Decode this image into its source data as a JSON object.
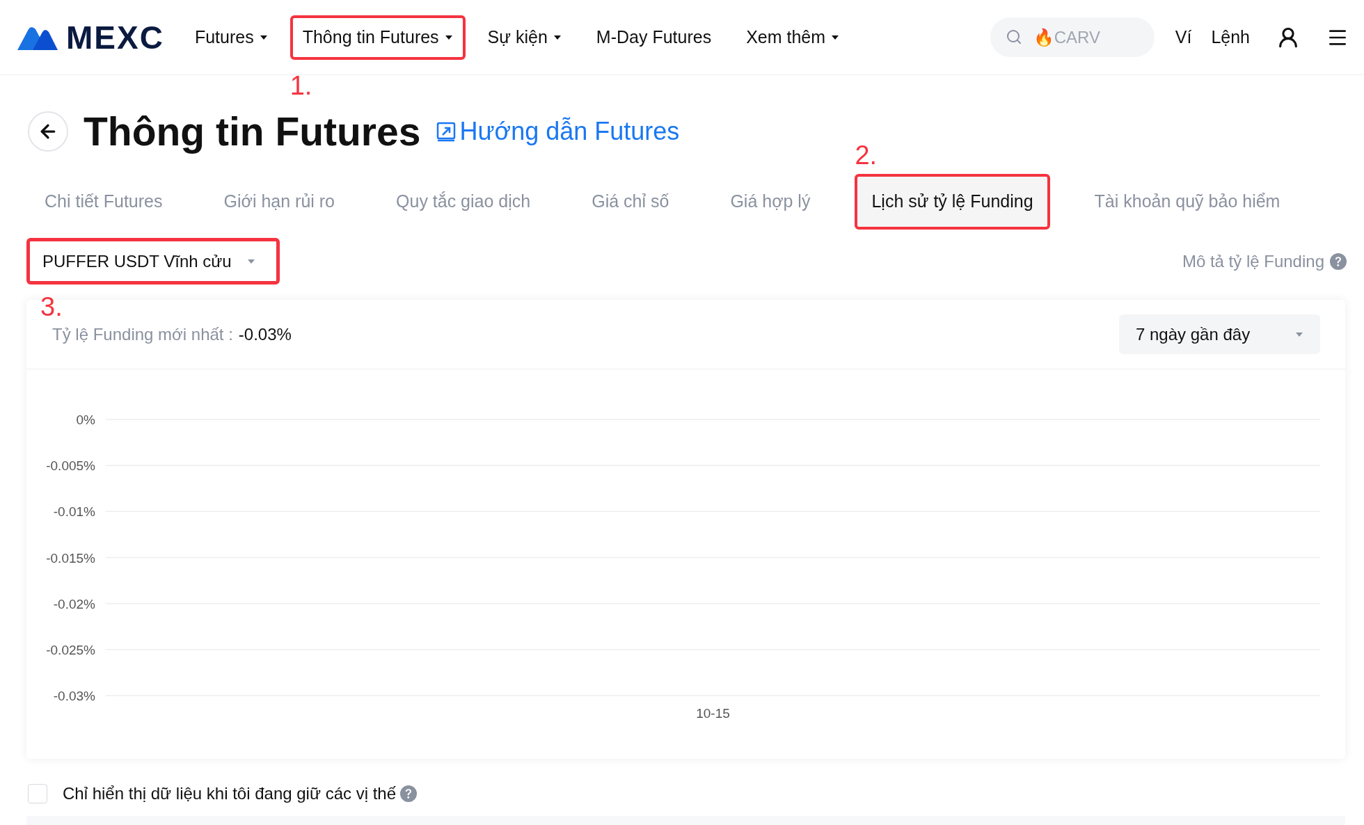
{
  "header": {
    "logo": "MEXC",
    "nav": [
      {
        "label": "Futures",
        "dropdown": true,
        "highlighted": false
      },
      {
        "label": "Thông tin Futures",
        "dropdown": true,
        "highlighted": true,
        "annotation": "1."
      },
      {
        "label": "Sự kiện",
        "dropdown": true,
        "highlighted": false
      },
      {
        "label": "M-Day Futures",
        "dropdown": false,
        "highlighted": false
      },
      {
        "label": "Xem thêm",
        "dropdown": true,
        "highlighted": false
      }
    ],
    "search": {
      "placeholder": "🔥CARV"
    },
    "links": [
      "Ví",
      "Lệnh"
    ]
  },
  "page": {
    "title": "Thông tin Futures",
    "guide_link": "Hướng dẫn Futures"
  },
  "tabs": [
    {
      "label": "Chi tiết Futures",
      "selected": false,
      "highlighted": false
    },
    {
      "label": "Giới hạn rủi ro",
      "selected": false,
      "highlighted": false
    },
    {
      "label": "Quy tắc giao dịch",
      "selected": false,
      "highlighted": false
    },
    {
      "label": "Giá chỉ số",
      "selected": false,
      "highlighted": false
    },
    {
      "label": "Giá hợp lý",
      "selected": false,
      "highlighted": false
    },
    {
      "label": "Lịch sử tỷ lệ Funding",
      "selected": true,
      "highlighted": true,
      "annotation": "2."
    },
    {
      "label": "Tài khoản quỹ bảo hiểm",
      "selected": false,
      "highlighted": false
    }
  ],
  "contract_select": {
    "value": "PUFFER USDT Vĩnh cửu",
    "highlighted": true,
    "annotation": "3."
  },
  "funding_description_link": "Mô tả tỷ lệ Funding",
  "card": {
    "latest_label": "Tỷ lệ Funding mới nhất :",
    "latest_value": "-0.03%",
    "period_select": "7 ngày gần đây",
    "chart_data": {
      "type": "line",
      "grid": true,
      "categories": [
        "10-15"
      ],
      "ylim": [
        -0.03,
        0
      ],
      "yticks": [
        {
          "value": 0,
          "label": "0%"
        },
        {
          "value": -0.005,
          "label": "-0.005%"
        },
        {
          "value": -0.01,
          "label": "-0.01%"
        },
        {
          "value": -0.015,
          "label": "-0.015%"
        },
        {
          "value": -0.02,
          "label": "-0.02%"
        },
        {
          "value": -0.025,
          "label": "-0.025%"
        },
        {
          "value": -0.03,
          "label": "-0.03%"
        }
      ]
    }
  },
  "positions_filter": {
    "label": "Chỉ hiển thị dữ liệu khi tôi đang giữ các vị thế",
    "checked": false
  }
}
